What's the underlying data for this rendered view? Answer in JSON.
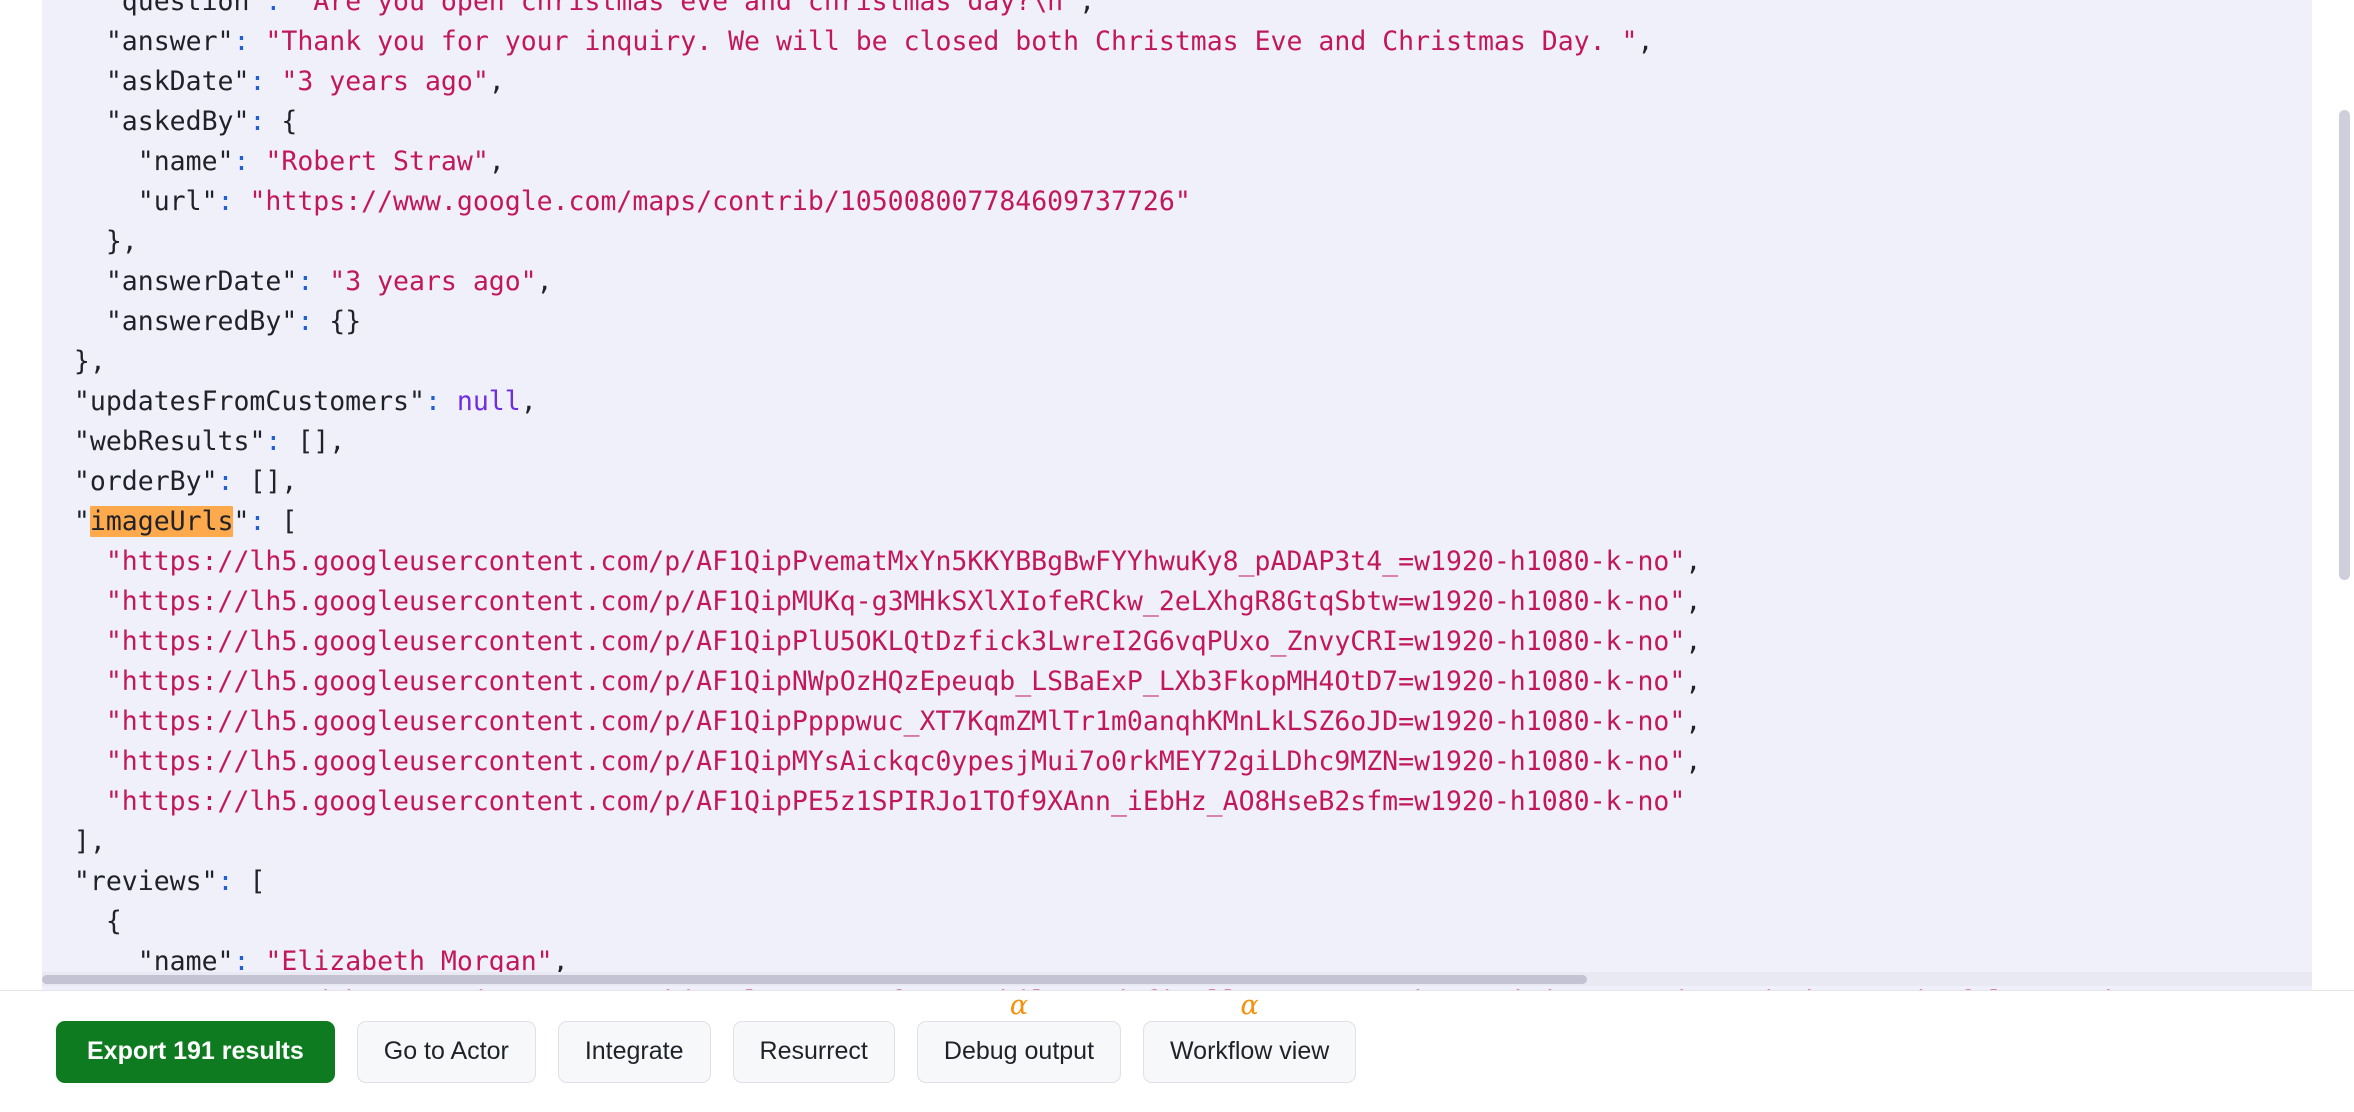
{
  "code_viewer": {
    "search_highlight_term": "imageUrls",
    "highlight_color": "#ffa94d",
    "background_color": "#f0f0fa",
    "lines": [
      {
        "indent": 4,
        "parts": [
          {
            "t": "\"",
            "c": "q"
          },
          {
            "t": "question",
            "c": "k"
          },
          {
            "t": "\"",
            "c": "q"
          },
          {
            "t": ": ",
            "c": "c"
          },
          {
            "t": "\"Are you open christmas eve and christmas day?\\n\"",
            "c": "s"
          },
          {
            "t": ",",
            "c": "p"
          }
        ]
      },
      {
        "indent": 4,
        "parts": [
          {
            "t": "\"",
            "c": "q"
          },
          {
            "t": "answer",
            "c": "k"
          },
          {
            "t": "\"",
            "c": "q"
          },
          {
            "t": ": ",
            "c": "c"
          },
          {
            "t": "\"Thank you for your inquiry. We will be closed both Christmas Eve and Christmas Day. \"",
            "c": "s"
          },
          {
            "t": ",",
            "c": "p"
          }
        ]
      },
      {
        "indent": 4,
        "parts": [
          {
            "t": "\"",
            "c": "q"
          },
          {
            "t": "askDate",
            "c": "k"
          },
          {
            "t": "\"",
            "c": "q"
          },
          {
            "t": ": ",
            "c": "c"
          },
          {
            "t": "\"3 years ago\"",
            "c": "s"
          },
          {
            "t": ",",
            "c": "p"
          }
        ]
      },
      {
        "indent": 4,
        "parts": [
          {
            "t": "\"",
            "c": "q"
          },
          {
            "t": "askedBy",
            "c": "k"
          },
          {
            "t": "\"",
            "c": "q"
          },
          {
            "t": ": ",
            "c": "c"
          },
          {
            "t": "{",
            "c": "p"
          }
        ]
      },
      {
        "indent": 6,
        "parts": [
          {
            "t": "\"",
            "c": "q"
          },
          {
            "t": "name",
            "c": "k"
          },
          {
            "t": "\"",
            "c": "q"
          },
          {
            "t": ": ",
            "c": "c"
          },
          {
            "t": "\"Robert Straw\"",
            "c": "s"
          },
          {
            "t": ",",
            "c": "p"
          }
        ]
      },
      {
        "indent": 6,
        "parts": [
          {
            "t": "\"",
            "c": "q"
          },
          {
            "t": "url",
            "c": "k"
          },
          {
            "t": "\"",
            "c": "q"
          },
          {
            "t": ": ",
            "c": "c"
          },
          {
            "t": "\"https://www.google.com/maps/contrib/105008007784609737726\"",
            "c": "s"
          }
        ]
      },
      {
        "indent": 4,
        "parts": [
          {
            "t": "},",
            "c": "p"
          }
        ]
      },
      {
        "indent": 4,
        "parts": [
          {
            "t": "\"",
            "c": "q"
          },
          {
            "t": "answerDate",
            "c": "k"
          },
          {
            "t": "\"",
            "c": "q"
          },
          {
            "t": ": ",
            "c": "c"
          },
          {
            "t": "\"3 years ago\"",
            "c": "s"
          },
          {
            "t": ",",
            "c": "p"
          }
        ]
      },
      {
        "indent": 4,
        "parts": [
          {
            "t": "\"",
            "c": "q"
          },
          {
            "t": "answeredBy",
            "c": "k"
          },
          {
            "t": "\"",
            "c": "q"
          },
          {
            "t": ": ",
            "c": "c"
          },
          {
            "t": "{}",
            "c": "p"
          }
        ]
      },
      {
        "indent": 2,
        "parts": [
          {
            "t": "},",
            "c": "p"
          }
        ]
      },
      {
        "indent": 2,
        "parts": [
          {
            "t": "\"",
            "c": "q"
          },
          {
            "t": "updatesFromCustomers",
            "c": "k"
          },
          {
            "t": "\"",
            "c": "q"
          },
          {
            "t": ": ",
            "c": "c"
          },
          {
            "t": "null",
            "c": "n"
          },
          {
            "t": ",",
            "c": "p"
          }
        ]
      },
      {
        "indent": 2,
        "parts": [
          {
            "t": "\"",
            "c": "q"
          },
          {
            "t": "webResults",
            "c": "k"
          },
          {
            "t": "\"",
            "c": "q"
          },
          {
            "t": ": ",
            "c": "c"
          },
          {
            "t": "[],",
            "c": "p"
          }
        ]
      },
      {
        "indent": 2,
        "parts": [
          {
            "t": "\"",
            "c": "q"
          },
          {
            "t": "orderBy",
            "c": "k"
          },
          {
            "t": "\"",
            "c": "q"
          },
          {
            "t": ": ",
            "c": "c"
          },
          {
            "t": "[],",
            "c": "p"
          }
        ]
      },
      {
        "indent": 2,
        "parts": [
          {
            "t": "\"",
            "c": "q"
          },
          {
            "t": "imageUrls",
            "c": "hl"
          },
          {
            "t": "\"",
            "c": "q"
          },
          {
            "t": ": ",
            "c": "c"
          },
          {
            "t": "[",
            "c": "p"
          }
        ]
      },
      {
        "indent": 4,
        "parts": [
          {
            "t": "\"https://lh5.googleusercontent.com/p/AF1QipPvematMxYn5KKYBBgBwFYYhwuKy8_pADAP3t4_=w1920-h1080-k-no\"",
            "c": "s"
          },
          {
            "t": ",",
            "c": "p"
          }
        ]
      },
      {
        "indent": 4,
        "parts": [
          {
            "t": "\"https://lh5.googleusercontent.com/p/AF1QipMUKq-g3MHkSXlXIofeRCkw_2eLXhgR8GtqSbtw=w1920-h1080-k-no\"",
            "c": "s"
          },
          {
            "t": ",",
            "c": "p"
          }
        ]
      },
      {
        "indent": 4,
        "parts": [
          {
            "t": "\"https://lh5.googleusercontent.com/p/AF1QipPlU5OKLQtDzfick3LwreI2G6vqPUxo_ZnvyCRI=w1920-h1080-k-no\"",
            "c": "s"
          },
          {
            "t": ",",
            "c": "p"
          }
        ]
      },
      {
        "indent": 4,
        "parts": [
          {
            "t": "\"https://lh5.googleusercontent.com/p/AF1QipNWpOzHQzEpeuqb_LSBaExP_LXb3FkopMH4OtD7=w1920-h1080-k-no\"",
            "c": "s"
          },
          {
            "t": ",",
            "c": "p"
          }
        ]
      },
      {
        "indent": 4,
        "parts": [
          {
            "t": "\"https://lh5.googleusercontent.com/p/AF1QipPpppwuc_XT7KqmZMlTr1m0anqhKMnLkLSZ6oJD=w1920-h1080-k-no\"",
            "c": "s"
          },
          {
            "t": ",",
            "c": "p"
          }
        ]
      },
      {
        "indent": 4,
        "parts": [
          {
            "t": "\"https://lh5.googleusercontent.com/p/AF1QipMYsAickqc0ypesjMui7o0rkMEY72giLDhc9MZN=w1920-h1080-k-no\"",
            "c": "s"
          },
          {
            "t": ",",
            "c": "p"
          }
        ]
      },
      {
        "indent": 4,
        "parts": [
          {
            "t": "\"https://lh5.googleusercontent.com/p/AF1QipPE5z1SPIRJo1TOf9XAnn_iEbHz_AO8HseB2sfm=w1920-h1080-k-no\"",
            "c": "s"
          }
        ]
      },
      {
        "indent": 2,
        "parts": [
          {
            "t": "],",
            "c": "p"
          }
        ]
      },
      {
        "indent": 2,
        "parts": [
          {
            "t": "\"",
            "c": "q"
          },
          {
            "t": "reviews",
            "c": "k"
          },
          {
            "t": "\"",
            "c": "q"
          },
          {
            "t": ": ",
            "c": "c"
          },
          {
            "t": "[",
            "c": "p"
          }
        ]
      },
      {
        "indent": 4,
        "parts": [
          {
            "t": "{",
            "c": "p"
          }
        ]
      },
      {
        "indent": 6,
        "parts": [
          {
            "t": "\"",
            "c": "q"
          },
          {
            "t": "name",
            "c": "k"
          },
          {
            "t": "\"",
            "c": "q"
          },
          {
            "t": ": ",
            "c": "c"
          },
          {
            "t": "\"Elizabeth Morgan\"",
            "c": "s"
          },
          {
            "t": ",",
            "c": "p"
          }
        ]
      },
      {
        "indent": 6,
        "parts": [
          {
            "t": "\"",
            "c": "q"
          },
          {
            "t": "text",
            "c": "k"
          },
          {
            "t": "\"",
            "c": "q"
          },
          {
            "t": ": ",
            "c": "c"
          },
          {
            "t": "\"I'd been saving to get this place ... for a while and finally got enough to visit... today I had a wonderful experi",
            "c": "s"
          }
        ]
      }
    ]
  },
  "action_bar": {
    "buttons": [
      {
        "label": "Export 191 results",
        "style": "primary",
        "badge": ""
      },
      {
        "label": "Go to Actor",
        "style": "secondary",
        "badge": ""
      },
      {
        "label": "Integrate",
        "style": "secondary",
        "badge": ""
      },
      {
        "label": "Resurrect",
        "style": "secondary",
        "badge": ""
      },
      {
        "label": "Debug output",
        "style": "secondary",
        "badge": "α"
      },
      {
        "label": "Workflow view",
        "style": "secondary",
        "badge": "α"
      }
    ],
    "primary_color": "#0f7b20",
    "badge_color": "#f5920b"
  }
}
